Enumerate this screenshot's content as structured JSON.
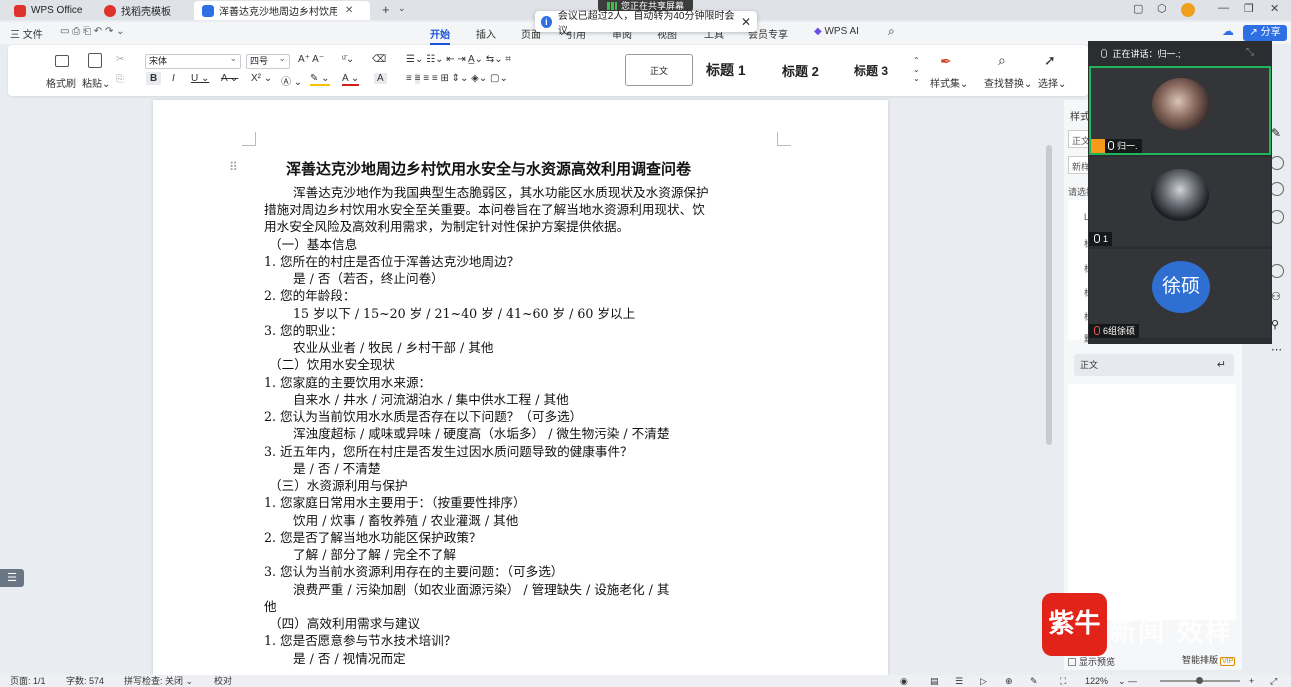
{
  "tabs": [
    {
      "label": "WPS Office",
      "color": "#e0322c"
    },
    {
      "label": "找稻壳模板",
      "color": "#e0322c"
    },
    {
      "label": "浑善达克沙地周边乡村饮用小",
      "color": "#2f6fe4"
    }
  ],
  "share_indicator": "您正在共享屏幕",
  "meeting_notice": "会议已超过2人，自动转为40分钟限时会议。",
  "menu": {
    "file": "三 文件",
    "tabs": [
      "开始",
      "插入",
      "页面",
      "引用",
      "审阅",
      "视图",
      "工具",
      "会员专享",
      "WPS AI"
    ],
    "active": "开始",
    "share": "分享"
  },
  "ribbon": {
    "format_painter": "格式刷",
    "paste": "粘贴",
    "font_name": "宋体",
    "font_size": "四号",
    "style_normal": "正文",
    "style_h1": "标题 1",
    "style_h2": "标题 2",
    "style_h3": "标题 3",
    "style_set": "样式集",
    "find_replace": "查找替换",
    "select": "选择"
  },
  "document": {
    "title": "浑善达克沙地周边乡村饮用水安全与水资源高效利用调查问卷",
    "lines": [
      "浑善达克沙地作为我国典型生态脆弱区，其水功能区水质现状及水资源保护",
      "措施对周边乡村饮用水安全至关重要。本问卷旨在了解当地水资源利用现状、饮",
      "用水安全风险及高效利用需求，为制定针对性保护方案提供依据。",
      "（一）基本信息",
      "1. 您所在的村庄是否位于浑善达克沙地周边？",
      "是 / 否（若否，终止问卷）",
      "2. 您的年龄段：",
      "15 岁以下 /   15~20 岁 /   21~40 岁 /   41~60 岁 /   60 岁以上",
      "3. 您的职业：",
      "农业从业者 / 牧民 / 乡村干部 / 其他",
      "（二）饮用水安全现状",
      "1. 您家庭的主要饮用水来源：",
      "自来水 /   井水 /   河流湖泊水 /   集中供水工程 /   其他",
      "2. 您认为当前饮用水水质是否存在以下问题？（可多选）",
      "浑浊度超标 / 咸味或异味 / 硬度高（水垢多） / 微生物污染 / 不清楚",
      "3. 近五年内，您所在村庄是否发生过因水质问题导致的健康事件？",
      "是 /   否 /   不清楚",
      "（三）水资源利用与保护",
      "1. 您家庭日常用水主要用于：（按重要性排序）",
      "饮用 /   炊事 /   畜牧养殖 /   农业灌溉 /   其他",
      "2. 您是否了解当地水功能区保护政策？",
      "了解 /   部分了解 /   完全不了解",
      "3. 您认为当前水资源利用存在的主要问题：（可多选）",
      "浪费严重 /   污染加剧（如农业面源污染） /   管理缺失 /   设施老化 /   其",
      "他",
      "（四）高效利用需求与建议",
      "1. 您是否愿意参与节水技术培训？",
      "是 /   否 /   视情况而定"
    ]
  },
  "meeting": {
    "speaking": "正在讲话：归一.;",
    "participants": [
      {
        "label": "归一."
      },
      {
        "label": "1"
      },
      {
        "label": "6组徐硕",
        "initials": "徐硕"
      }
    ]
  },
  "style_pane": {
    "header": "样式",
    "items": [
      "正文",
      "新样",
      "请选择",
      "Li",
      "标",
      "标",
      "标",
      "标",
      "默"
    ],
    "normal": "正文",
    "show_preview": "显示预览",
    "smart_layout": "智能排版",
    "vip": "VIP",
    "logo_text": "紫牛",
    "logo_ghost": "新闻 效样"
  },
  "status": {
    "page": "页面: 1/1",
    "words": "字数: 574",
    "spell": "拼写检查: 关闭",
    "proof": "校对",
    "zoom": "122%"
  }
}
